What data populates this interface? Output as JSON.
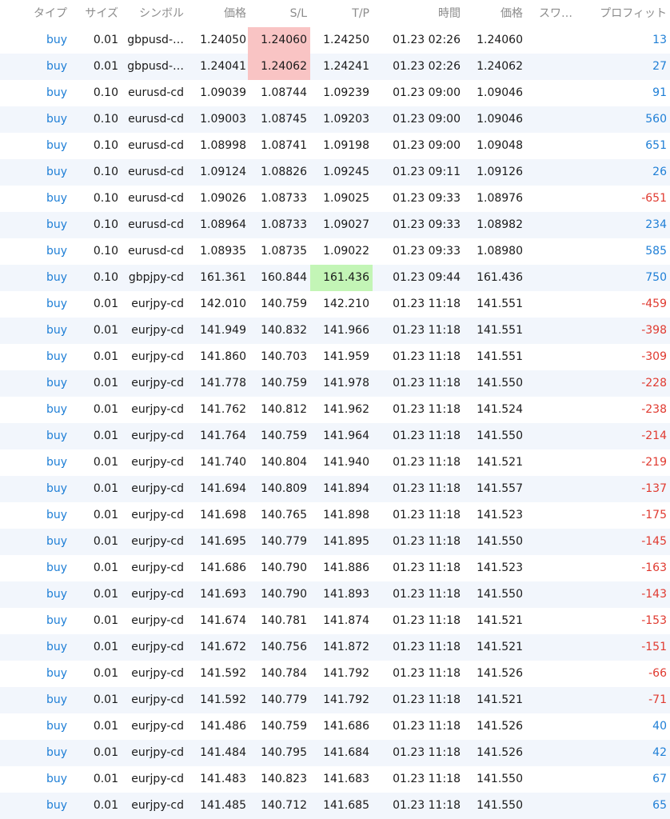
{
  "header": {
    "type": "タイプ",
    "size": "サイズ",
    "symbol": "シンボル",
    "price": "価格",
    "sl": "S/L",
    "tp": "T/P",
    "time": "時間",
    "current_price": "価格",
    "swap": "スワ…",
    "profit": "プロフィット"
  },
  "colors": {
    "buy_text": "#1f7fd6",
    "profit_positive": "#1f7fd6",
    "profit_negative": "#e03a30",
    "sl_highlight": "#f9c4c4",
    "tp_highlight": "#c3f5b6",
    "alt_row": "#f2f6fc"
  },
  "rows": [
    {
      "type": "buy",
      "size": "0.01",
      "symbol": "gbpusd-…",
      "price": "1.24050",
      "sl": "1.24060",
      "tp": "1.24250",
      "time": "01.23 02:26",
      "current": "1.24060",
      "swap": "",
      "profit": "13",
      "sl_hl": "red",
      "tp_hl": ""
    },
    {
      "type": "buy",
      "size": "0.01",
      "symbol": "gbpusd-…",
      "price": "1.24041",
      "sl": "1.24062",
      "tp": "1.24241",
      "time": "01.23 02:26",
      "current": "1.24062",
      "swap": "",
      "profit": "27",
      "sl_hl": "red",
      "tp_hl": ""
    },
    {
      "type": "buy",
      "size": "0.10",
      "symbol": "eurusd-cd",
      "price": "1.09039",
      "sl": "1.08744",
      "tp": "1.09239",
      "time": "01.23 09:00",
      "current": "1.09046",
      "swap": "",
      "profit": "91",
      "sl_hl": "",
      "tp_hl": ""
    },
    {
      "type": "buy",
      "size": "0.10",
      "symbol": "eurusd-cd",
      "price": "1.09003",
      "sl": "1.08745",
      "tp": "1.09203",
      "time": "01.23 09:00",
      "current": "1.09046",
      "swap": "",
      "profit": "560",
      "sl_hl": "",
      "tp_hl": ""
    },
    {
      "type": "buy",
      "size": "0.10",
      "symbol": "eurusd-cd",
      "price": "1.08998",
      "sl": "1.08741",
      "tp": "1.09198",
      "time": "01.23 09:00",
      "current": "1.09048",
      "swap": "",
      "profit": "651",
      "sl_hl": "",
      "tp_hl": ""
    },
    {
      "type": "buy",
      "size": "0.10",
      "symbol": "eurusd-cd",
      "price": "1.09124",
      "sl": "1.08826",
      "tp": "1.09245",
      "time": "01.23 09:11",
      "current": "1.09126",
      "swap": "",
      "profit": "26",
      "sl_hl": "",
      "tp_hl": ""
    },
    {
      "type": "buy",
      "size": "0.10",
      "symbol": "eurusd-cd",
      "price": "1.09026",
      "sl": "1.08733",
      "tp": "1.09025",
      "time": "01.23 09:33",
      "current": "1.08976",
      "swap": "",
      "profit": "-651",
      "sl_hl": "",
      "tp_hl": ""
    },
    {
      "type": "buy",
      "size": "0.10",
      "symbol": "eurusd-cd",
      "price": "1.08964",
      "sl": "1.08733",
      "tp": "1.09027",
      "time": "01.23 09:33",
      "current": "1.08982",
      "swap": "",
      "profit": "234",
      "sl_hl": "",
      "tp_hl": ""
    },
    {
      "type": "buy",
      "size": "0.10",
      "symbol": "eurusd-cd",
      "price": "1.08935",
      "sl": "1.08735",
      "tp": "1.09022",
      "time": "01.23 09:33",
      "current": "1.08980",
      "swap": "",
      "profit": "585",
      "sl_hl": "",
      "tp_hl": ""
    },
    {
      "type": "buy",
      "size": "0.10",
      "symbol": "gbpjpy-cd",
      "price": "161.361",
      "sl": "160.844",
      "tp": "161.436",
      "time": "01.23 09:44",
      "current": "161.436",
      "swap": "",
      "profit": "750",
      "sl_hl": "",
      "tp_hl": "green"
    },
    {
      "type": "buy",
      "size": "0.01",
      "symbol": "eurjpy-cd",
      "price": "142.010",
      "sl": "140.759",
      "tp": "142.210",
      "time": "01.23 11:18",
      "current": "141.551",
      "swap": "",
      "profit": "-459",
      "sl_hl": "",
      "tp_hl": ""
    },
    {
      "type": "buy",
      "size": "0.01",
      "symbol": "eurjpy-cd",
      "price": "141.949",
      "sl": "140.832",
      "tp": "141.966",
      "time": "01.23 11:18",
      "current": "141.551",
      "swap": "",
      "profit": "-398",
      "sl_hl": "",
      "tp_hl": ""
    },
    {
      "type": "buy",
      "size": "0.01",
      "symbol": "eurjpy-cd",
      "price": "141.860",
      "sl": "140.703",
      "tp": "141.959",
      "time": "01.23 11:18",
      "current": "141.551",
      "swap": "",
      "profit": "-309",
      "sl_hl": "",
      "tp_hl": ""
    },
    {
      "type": "buy",
      "size": "0.01",
      "symbol": "eurjpy-cd",
      "price": "141.778",
      "sl": "140.759",
      "tp": "141.978",
      "time": "01.23 11:18",
      "current": "141.550",
      "swap": "",
      "profit": "-228",
      "sl_hl": "",
      "tp_hl": ""
    },
    {
      "type": "buy",
      "size": "0.01",
      "symbol": "eurjpy-cd",
      "price": "141.762",
      "sl": "140.812",
      "tp": "141.962",
      "time": "01.23 11:18",
      "current": "141.524",
      "swap": "",
      "profit": "-238",
      "sl_hl": "",
      "tp_hl": ""
    },
    {
      "type": "buy",
      "size": "0.01",
      "symbol": "eurjpy-cd",
      "price": "141.764",
      "sl": "140.759",
      "tp": "141.964",
      "time": "01.23 11:18",
      "current": "141.550",
      "swap": "",
      "profit": "-214",
      "sl_hl": "",
      "tp_hl": ""
    },
    {
      "type": "buy",
      "size": "0.01",
      "symbol": "eurjpy-cd",
      "price": "141.740",
      "sl": "140.804",
      "tp": "141.940",
      "time": "01.23 11:18",
      "current": "141.521",
      "swap": "",
      "profit": "-219",
      "sl_hl": "",
      "tp_hl": ""
    },
    {
      "type": "buy",
      "size": "0.01",
      "symbol": "eurjpy-cd",
      "price": "141.694",
      "sl": "140.809",
      "tp": "141.894",
      "time": "01.23 11:18",
      "current": "141.557",
      "swap": "",
      "profit": "-137",
      "sl_hl": "",
      "tp_hl": ""
    },
    {
      "type": "buy",
      "size": "0.01",
      "symbol": "eurjpy-cd",
      "price": "141.698",
      "sl": "140.765",
      "tp": "141.898",
      "time": "01.23 11:18",
      "current": "141.523",
      "swap": "",
      "profit": "-175",
      "sl_hl": "",
      "tp_hl": ""
    },
    {
      "type": "buy",
      "size": "0.01",
      "symbol": "eurjpy-cd",
      "price": "141.695",
      "sl": "140.779",
      "tp": "141.895",
      "time": "01.23 11:18",
      "current": "141.550",
      "swap": "",
      "profit": "-145",
      "sl_hl": "",
      "tp_hl": ""
    },
    {
      "type": "buy",
      "size": "0.01",
      "symbol": "eurjpy-cd",
      "price": "141.686",
      "sl": "140.790",
      "tp": "141.886",
      "time": "01.23 11:18",
      "current": "141.523",
      "swap": "",
      "profit": "-163",
      "sl_hl": "",
      "tp_hl": ""
    },
    {
      "type": "buy",
      "size": "0.01",
      "symbol": "eurjpy-cd",
      "price": "141.693",
      "sl": "140.790",
      "tp": "141.893",
      "time": "01.23 11:18",
      "current": "141.550",
      "swap": "",
      "profit": "-143",
      "sl_hl": "",
      "tp_hl": ""
    },
    {
      "type": "buy",
      "size": "0.01",
      "symbol": "eurjpy-cd",
      "price": "141.674",
      "sl": "140.781",
      "tp": "141.874",
      "time": "01.23 11:18",
      "current": "141.521",
      "swap": "",
      "profit": "-153",
      "sl_hl": "",
      "tp_hl": ""
    },
    {
      "type": "buy",
      "size": "0.01",
      "symbol": "eurjpy-cd",
      "price": "141.672",
      "sl": "140.756",
      "tp": "141.872",
      "time": "01.23 11:18",
      "current": "141.521",
      "swap": "",
      "profit": "-151",
      "sl_hl": "",
      "tp_hl": ""
    },
    {
      "type": "buy",
      "size": "0.01",
      "symbol": "eurjpy-cd",
      "price": "141.592",
      "sl": "140.784",
      "tp": "141.792",
      "time": "01.23 11:18",
      "current": "141.526",
      "swap": "",
      "profit": "-66",
      "sl_hl": "",
      "tp_hl": ""
    },
    {
      "type": "buy",
      "size": "0.01",
      "symbol": "eurjpy-cd",
      "price": "141.592",
      "sl": "140.779",
      "tp": "141.792",
      "time": "01.23 11:18",
      "current": "141.521",
      "swap": "",
      "profit": "-71",
      "sl_hl": "",
      "tp_hl": ""
    },
    {
      "type": "buy",
      "size": "0.01",
      "symbol": "eurjpy-cd",
      "price": "141.486",
      "sl": "140.759",
      "tp": "141.686",
      "time": "01.23 11:18",
      "current": "141.526",
      "swap": "",
      "profit": "40",
      "sl_hl": "",
      "tp_hl": ""
    },
    {
      "type": "buy",
      "size": "0.01",
      "symbol": "eurjpy-cd",
      "price": "141.484",
      "sl": "140.795",
      "tp": "141.684",
      "time": "01.23 11:18",
      "current": "141.526",
      "swap": "",
      "profit": "42",
      "sl_hl": "",
      "tp_hl": ""
    },
    {
      "type": "buy",
      "size": "0.01",
      "symbol": "eurjpy-cd",
      "price": "141.483",
      "sl": "140.823",
      "tp": "141.683",
      "time": "01.23 11:18",
      "current": "141.550",
      "swap": "",
      "profit": "67",
      "sl_hl": "",
      "tp_hl": ""
    },
    {
      "type": "buy",
      "size": "0.01",
      "symbol": "eurjpy-cd",
      "price": "141.485",
      "sl": "140.712",
      "tp": "141.685",
      "time": "01.23 11:18",
      "current": "141.550",
      "swap": "",
      "profit": "65",
      "sl_hl": "",
      "tp_hl": ""
    }
  ]
}
